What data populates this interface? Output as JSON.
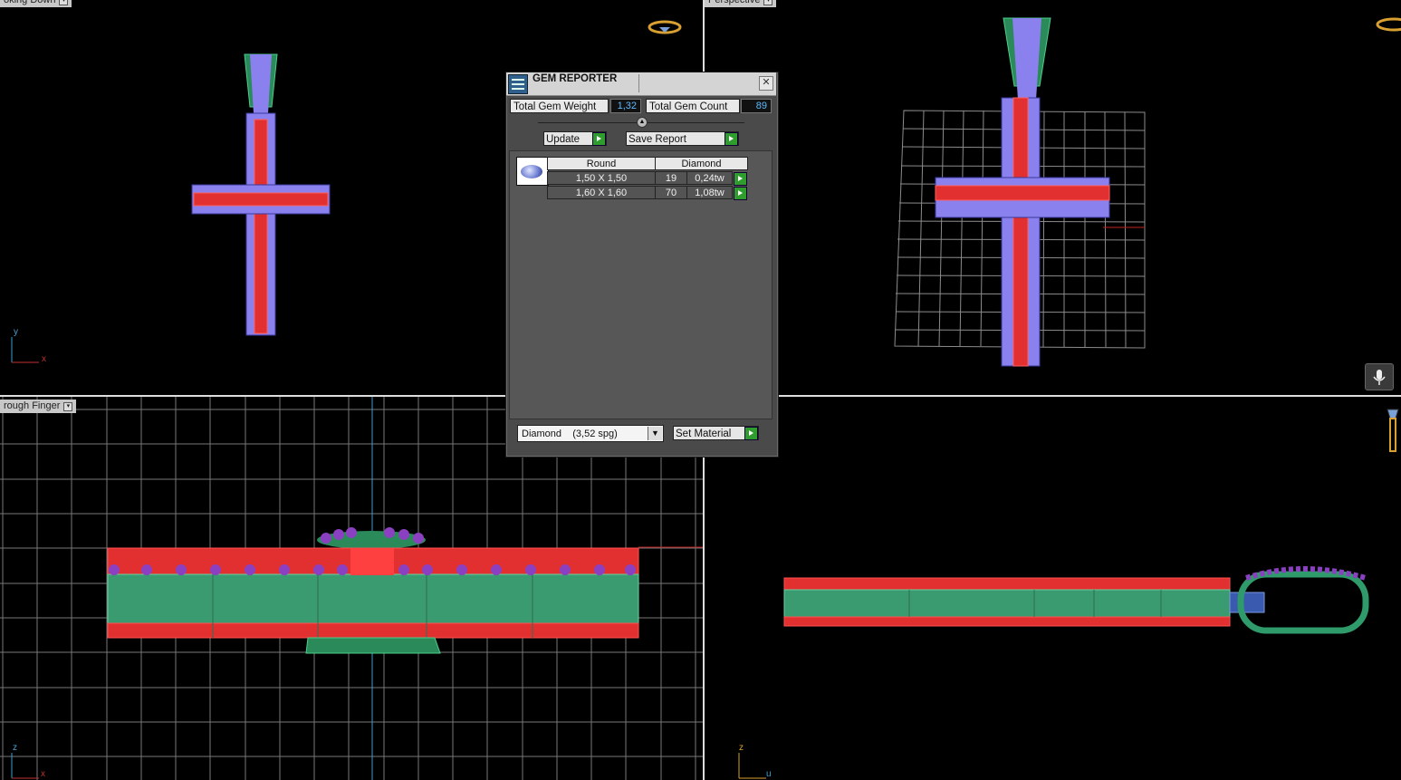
{
  "viewports": {
    "top_left": {
      "label": "oking Down"
    },
    "top_right": {
      "label": "Perspective"
    },
    "bottom_left": {
      "label": "rough Finger"
    },
    "bottom_right": {
      "label": ""
    }
  },
  "axes": {
    "top_left": {
      "v": "y",
      "h": "x"
    },
    "bottom_left": {
      "v": "z",
      "h": "x"
    },
    "bottom_right": {
      "v": "z",
      "h": "u"
    }
  },
  "dialog": {
    "title": "GEM REPORTER",
    "close_glyph": "✕",
    "total_gem_weight_label": "Total Gem Weight",
    "total_gem_weight_value": "1,32",
    "total_gem_count_label": "Total Gem Count",
    "total_gem_count_value": "89",
    "update_label": "Update",
    "save_report_label": "Save Report",
    "gem_table": {
      "shape": "Round",
      "material": "Diamond",
      "rows": [
        {
          "size": "1,50 X 1,50",
          "count": "19",
          "weight": "0,24tw"
        },
        {
          "size": "1,60 X 1,60",
          "count": "70",
          "weight": "1,08tw"
        }
      ]
    },
    "material_select_value": "Diamond    (3,52 spg)",
    "set_material_label": "Set Material"
  },
  "colors": {
    "metal_red": "#d42020",
    "metal_green": "#2f9a6a",
    "gems": "#8a7cf0",
    "grid": "#8c8c8c",
    "accent_go": "#2e9d2e"
  }
}
